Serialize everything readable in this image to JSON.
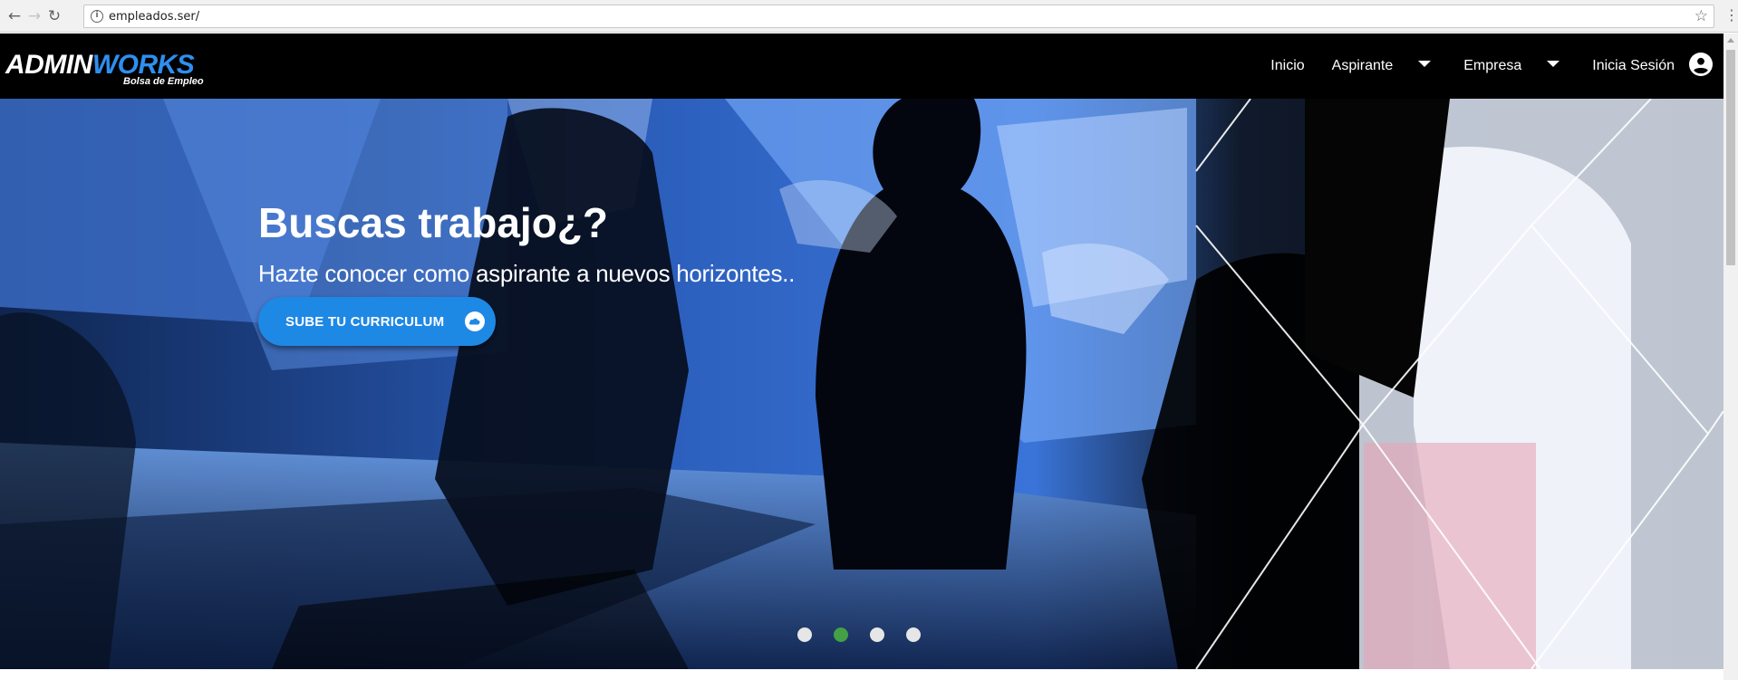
{
  "browser": {
    "url": "empleados.ser/",
    "back_icon": "arrow-left-icon",
    "forward_icon": "arrow-right-icon",
    "reload_icon": "reload-icon",
    "bookmark_icon": "star-icon",
    "menu_icon": "more-vertical-icon"
  },
  "site": {
    "logo_part1": "ADMIN",
    "logo_part2": "WORKS",
    "logo_tagline": "Bolsa de Empleo",
    "nav": {
      "inicio": "Inicio",
      "aspirante": "Aspirante",
      "empresa": "Empresa",
      "login": "Inicia Sesión"
    }
  },
  "hero": {
    "title": "Buscas trabajo¿?",
    "subtitle": "Hazte conocer como aspirante a nuevos horizontes..",
    "cta_label": "SUBE TU CURRICULUM",
    "cta_icon": "cloud-upload-icon",
    "slides_total": 4,
    "active_slide": 2
  },
  "colors": {
    "accent": "#1e88e5",
    "logo_blue": "#2e8ff0",
    "indicator_active": "#43a047",
    "navbar_bg": "#000000"
  }
}
